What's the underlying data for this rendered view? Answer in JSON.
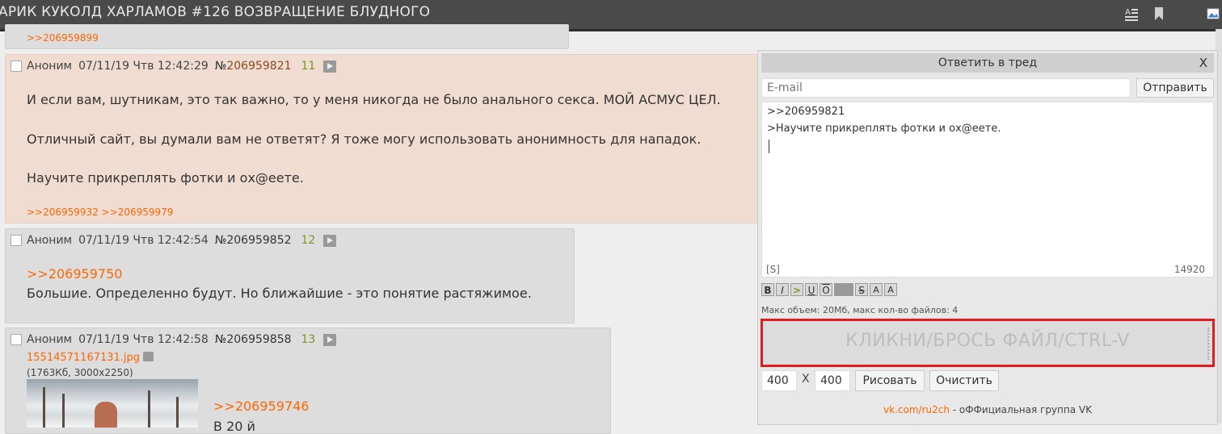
{
  "header": {
    "title": "АРИК КУКОЛД ХАРЛАМОВ #126 ВОЗВРАЩЕНИЕ БЛУДНОГО",
    "icons": [
      "text-format-icon",
      "bookmark-icon",
      "image-icon"
    ]
  },
  "posts": {
    "top_fragment": {
      "reply_link": ">>206959899"
    },
    "p1": {
      "author": "Аноним",
      "datetime": "07/11/19 Чтв 12:42:29",
      "num_prefix": "№",
      "num": "206959821",
      "index": "11",
      "lines": [
        "И если вам, шутникам, это так важно, то у меня никогда не было анального секса. МОЙ АСМУС ЦЕЛ.",
        "Отличный сайт, вы думали вам не ответят? Я тоже могу использовать анонимность для нападок.",
        "Научите прикреплять фотки и ох@еете."
      ],
      "replies": ">>206959932 >>206959979"
    },
    "p2": {
      "author": "Аноним",
      "datetime": "07/11/19 Чтв 12:42:54",
      "num": "№206959852",
      "index": "12",
      "reply_link": ">>206959750",
      "text": "Большие. Определенно будут. Но ближайшие - это понятие растяжимое."
    },
    "p3": {
      "author": "Аноним",
      "datetime": "07/11/19 Чтв 12:42:58",
      "num": "№206959858",
      "index": "13",
      "file_name": "15514571167131.jpg",
      "file_meta": "(1763Кб, 3000x2250)",
      "reply_link": ">>206959746",
      "text_partial": "В 20 й"
    }
  },
  "reply_form": {
    "title": "Ответить в тред",
    "close": "X",
    "email_placeholder": "E-mail",
    "send": "Отправить",
    "message_lines": [
      ">>206959821",
      ">Научите прикреплять фотки и ох@еете."
    ],
    "spoiler": "[S]",
    "counter": "14920",
    "markup_buttons": [
      "B",
      "I",
      ">",
      "U",
      "O",
      "",
      "S",
      "A",
      "A"
    ],
    "limits": "Макс объем: 20Мб, макс кол-во файлов: 4",
    "dropzone": "КЛИКНИ/БРОСЬ ФАЙЛ/CTRL-V",
    "width": "400",
    "x": "X",
    "height": "400",
    "draw": "Рисовать",
    "clear": "Очистить",
    "footer_link": "vk.com/ru2ch",
    "footer_text": " - оФФициальная группа VK"
  },
  "colors": {
    "accent": "#ff6600",
    "highlight_post": "#f0dcd0",
    "dropzone_border": "#e11b22"
  }
}
